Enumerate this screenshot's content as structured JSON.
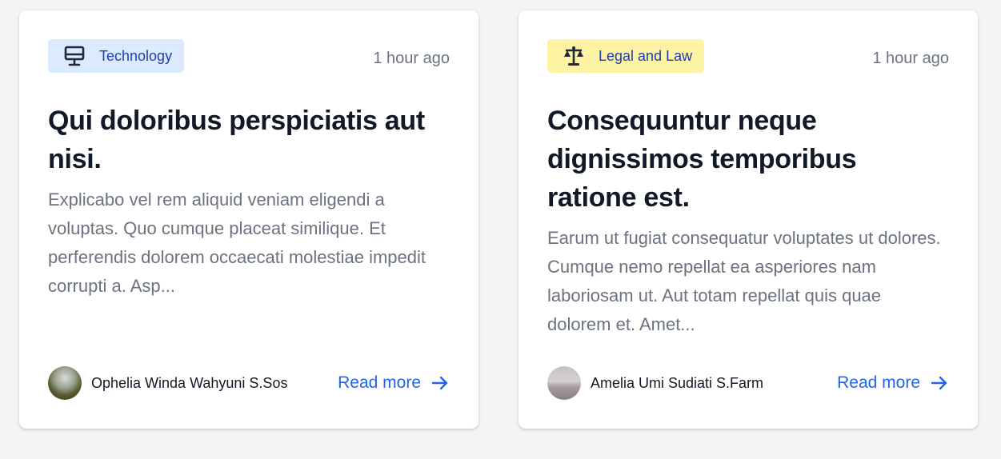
{
  "cards": [
    {
      "category": "Technology",
      "category_icon": "monitor-icon",
      "time": "1 hour ago",
      "title": "Qui doloribus perspiciatis aut nisi.",
      "excerpt": "Explicabo vel rem aliquid veniam eligendi a voluptas. Quo cumque placeat similique. Et perferendis dolorem occaecati molestiae impedit corrupti a. Asp...",
      "author": "Ophelia Winda Wahyuni S.Sos",
      "read_more": "Read more"
    },
    {
      "category": "Legal and Law",
      "category_icon": "scale-icon",
      "time": "1 hour ago",
      "title": "Consequuntur neque dignissimos temporibus ratione est.",
      "excerpt": "Earum ut fugiat consequatur voluptates ut dolores. Cumque nemo repellat ea asperiores nam laboriosam ut. Aut totam repellat quis quae dolorem et. Amet...",
      "author": "Amelia Umi Sudiati S.Farm",
      "read_more": "Read more"
    }
  ],
  "colors": {
    "page_bg": "#f3f4f6",
    "tech_badge_bg": "#dbeafe",
    "law_badge_bg": "#fef3a4",
    "badge_text": "#1e40af",
    "link": "#2563eb",
    "title": "#111827",
    "muted": "#6b7280"
  }
}
